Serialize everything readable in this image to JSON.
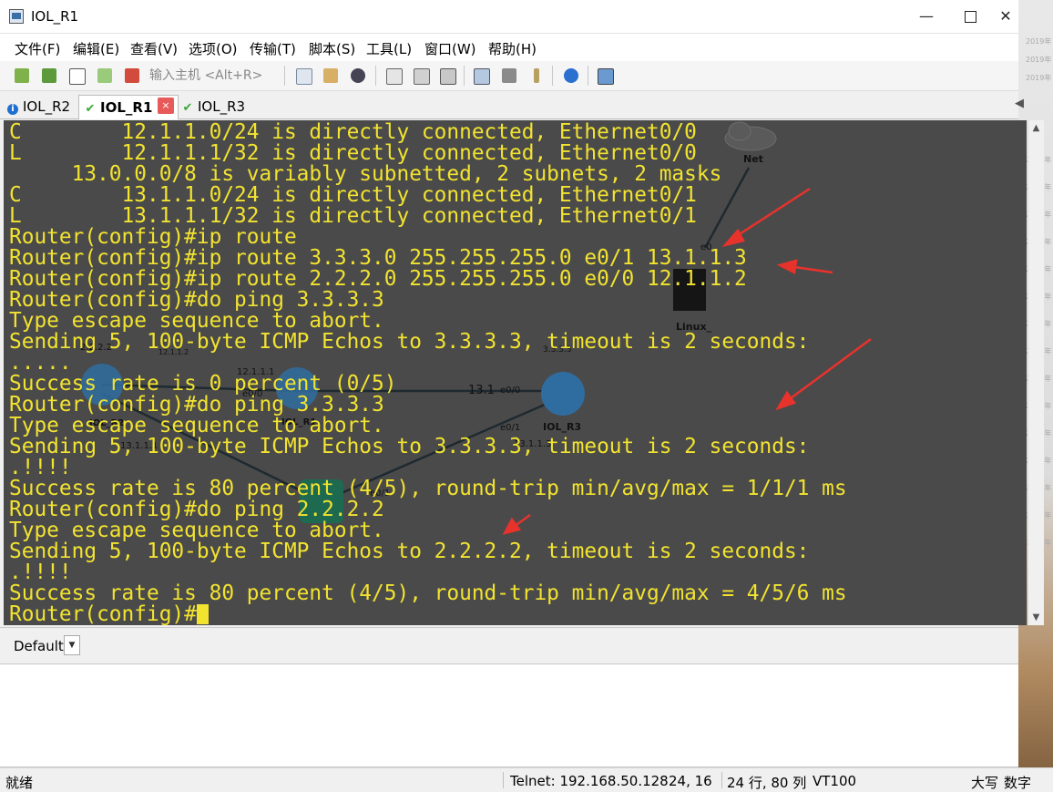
{
  "window": {
    "title": "IOL_R1"
  },
  "menu": [
    "文件(F)",
    "编辑(E)",
    "查看(V)",
    "选项(O)",
    "传输(T)",
    "脚本(S)",
    "工具(L)",
    "窗口(W)",
    "帮助(H)"
  ],
  "toolbar": {
    "host_input_placeholder": "输入主机 <Alt+R>"
  },
  "tabs": [
    {
      "label": "IOL_R2",
      "status": "info"
    },
    {
      "label": "IOL_R1",
      "status": "connected",
      "active": true
    },
    {
      "label": "IOL_R3",
      "status": "connected"
    }
  ],
  "terminal": {
    "lines": [
      "C        12.1.1.0/24 is directly connected, Ethernet0/0",
      "L        12.1.1.1/32 is directly connected, Ethernet0/0",
      "     13.0.0.0/8 is variably subnetted, 2 subnets, 2 masks",
      "C        13.1.1.0/24 is directly connected, Ethernet0/1",
      "L        13.1.1.1/32 is directly connected, Ethernet0/1",
      "Router(config)#ip route",
      "Router(config)#ip route 3.3.3.0 255.255.255.0 e0/1 13.1.1.3",
      "Router(config)#ip route 2.2.2.0 255.255.255.0 e0/0 12.1.1.2",
      "Router(config)#do ping 3.3.3.3",
      "Type escape sequence to abort.",
      "Sending 5, 100-byte ICMP Echos to 3.3.3.3, timeout is 2 seconds:",
      ".....",
      "Success rate is 0 percent (0/5)",
      "Router(config)#do ping 3.3.3.3",
      "Type escape sequence to abort.",
      "Sending 5, 100-byte ICMP Echos to 3.3.3.3, timeout is 2 seconds:",
      ".!!!!",
      "Success rate is 80 percent (4/5), round-trip min/avg/max = 1/1/1 ms",
      "Router(config)#do ping 2.2.2.2",
      "Type escape sequence to abort.",
      "Sending 5, 100-byte ICMP Echos to 2.2.2.2, timeout is 2 seconds:",
      ".!!!!",
      "Success rate is 80 percent (4/5), round-trip min/avg/max = 4/5/6 ms"
    ],
    "prompt": "Router(config)#",
    "text_color": "#f2e330",
    "background": "#4a4a4a"
  },
  "topology": {
    "nodes": [
      "Net",
      "Linux_",
      "IOL_R2",
      "IOL_R1",
      "IOL_R3"
    ],
    "labels": [
      "e0",
      "2.2.2.2",
      "12.1.1.2",
      "12.1.1.1",
      "e0/0",
      "13.1",
      "e0/0",
      "3.3.3.3",
      "e0/1",
      "13.1.1.1",
      "e0/1",
      "13.1.1.3"
    ]
  },
  "session_bar": {
    "selected": "Default"
  },
  "status": {
    "left": "就绪",
    "connection": "Telnet: 192.168.50.128",
    "cursor": "24,  16",
    "size": "24 行, 80 列",
    "terminal_type": "VT100",
    "caps": "大写",
    "num": "数字"
  }
}
